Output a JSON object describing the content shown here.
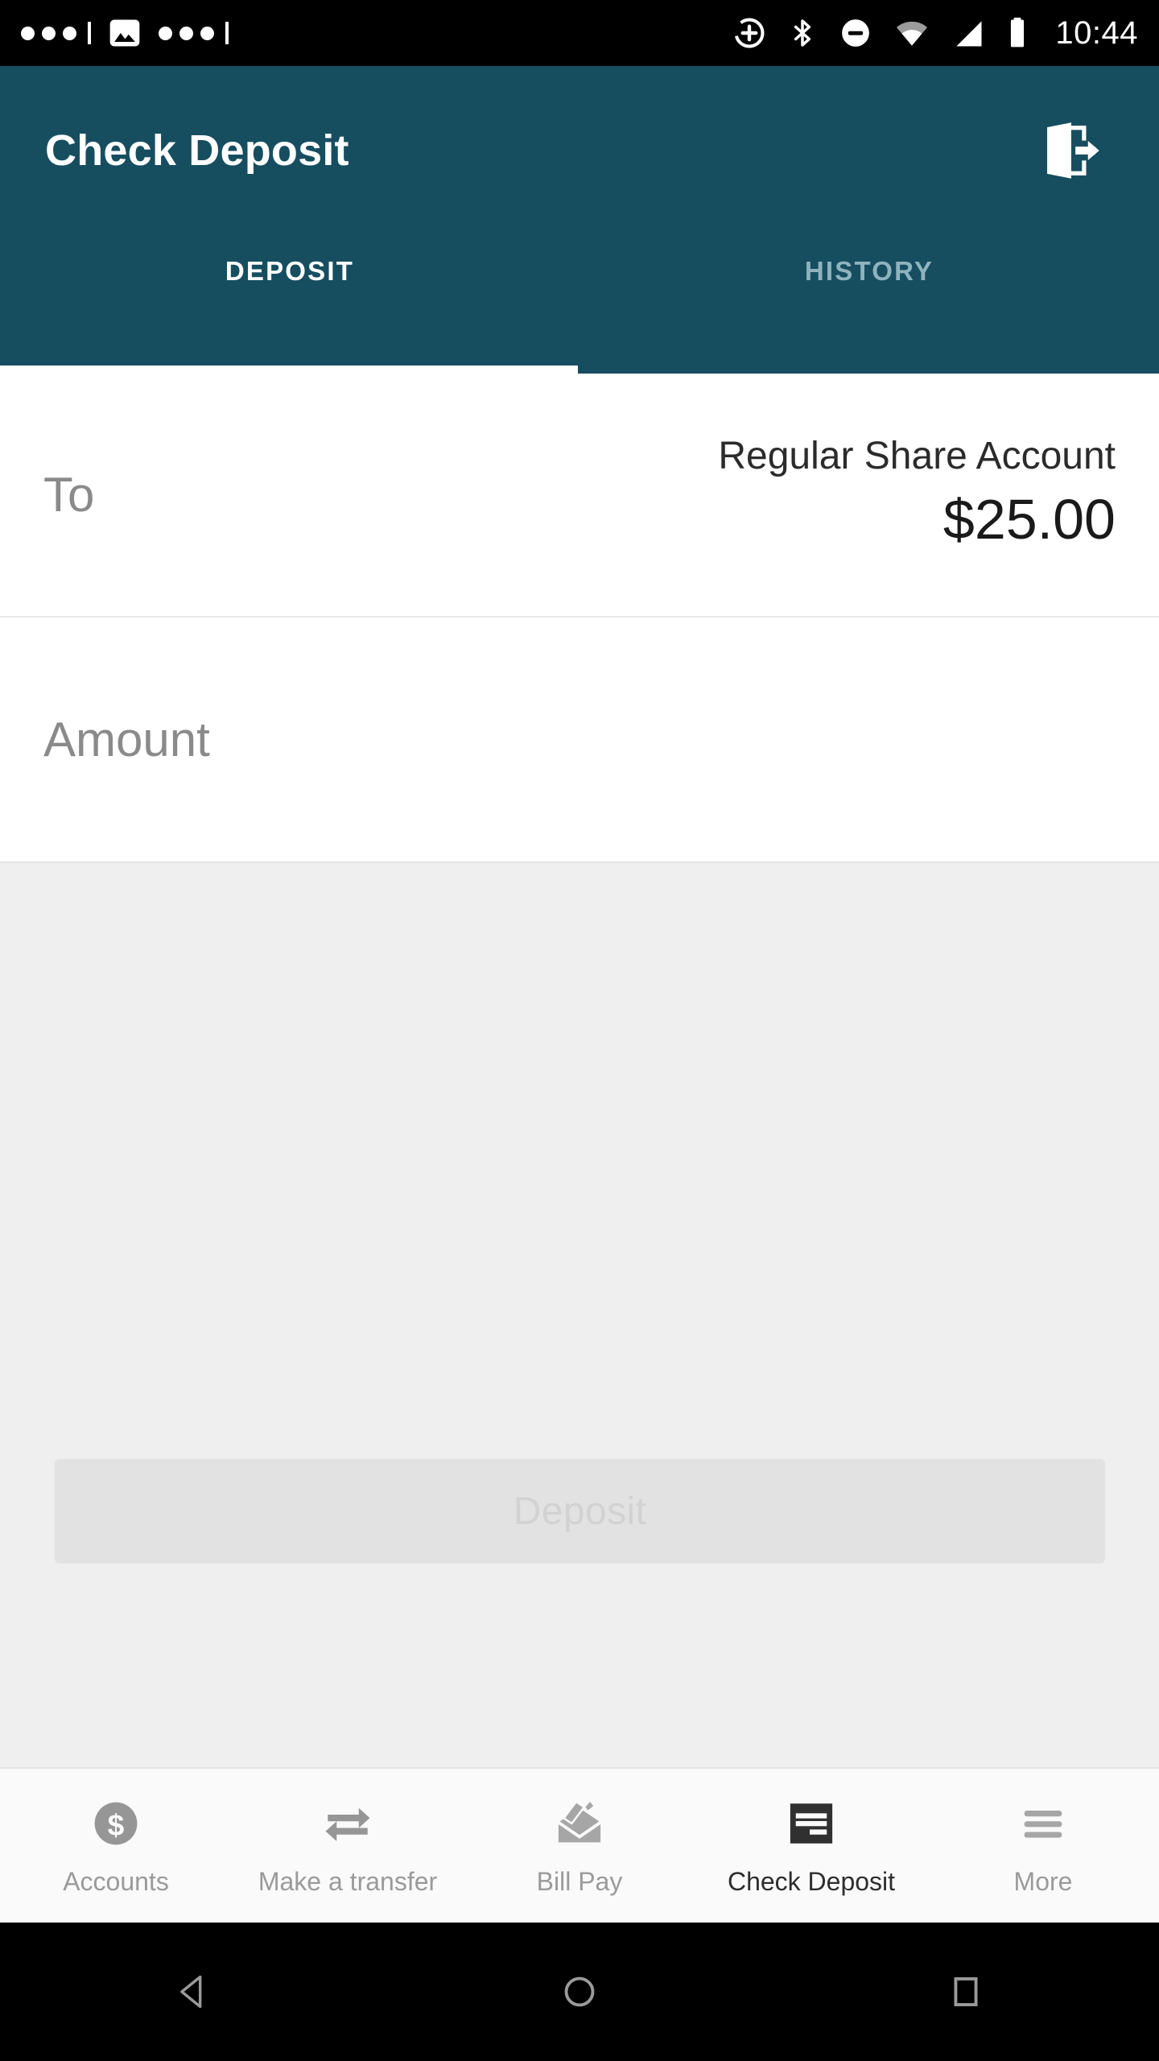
{
  "status_bar": {
    "time": "10:44",
    "left_icons": [
      "dots-indicator",
      "screenshot-image-icon",
      "dots-indicator"
    ],
    "right_icons": [
      "location-add-icon",
      "bluetooth-icon",
      "do-not-disturb-icon",
      "wifi-icon",
      "cellular-signal-icon",
      "battery-icon"
    ]
  },
  "app_bar": {
    "title": "Check Deposit",
    "logout_icon": "logout-icon",
    "background_color": "#164E60"
  },
  "tabs": [
    {
      "label": "DEPOSIT",
      "active": true
    },
    {
      "label": "HISTORY",
      "active": false
    }
  ],
  "form": {
    "to_label": "To",
    "account_name": "Regular Share Account",
    "account_balance": "$25.00",
    "amount_placeholder": "Amount",
    "amount_value": ""
  },
  "actions": {
    "deposit_label": "Deposit",
    "deposit_enabled": false
  },
  "bottom_nav": [
    {
      "label": "Accounts",
      "icon": "dollar-circle-icon",
      "active": false
    },
    {
      "label": "Make a transfer",
      "icon": "transfer-arrows-icon",
      "active": false
    },
    {
      "label": "Bill Pay",
      "icon": "envelope-pen-icon",
      "active": false
    },
    {
      "label": "Check Deposit",
      "icon": "check-document-icon",
      "active": true
    },
    {
      "label": "More",
      "icon": "hamburger-menu-icon",
      "active": false
    }
  ],
  "system_nav": {
    "back": "back-triangle-icon",
    "home": "home-circle-icon",
    "recents": "recents-square-icon"
  }
}
